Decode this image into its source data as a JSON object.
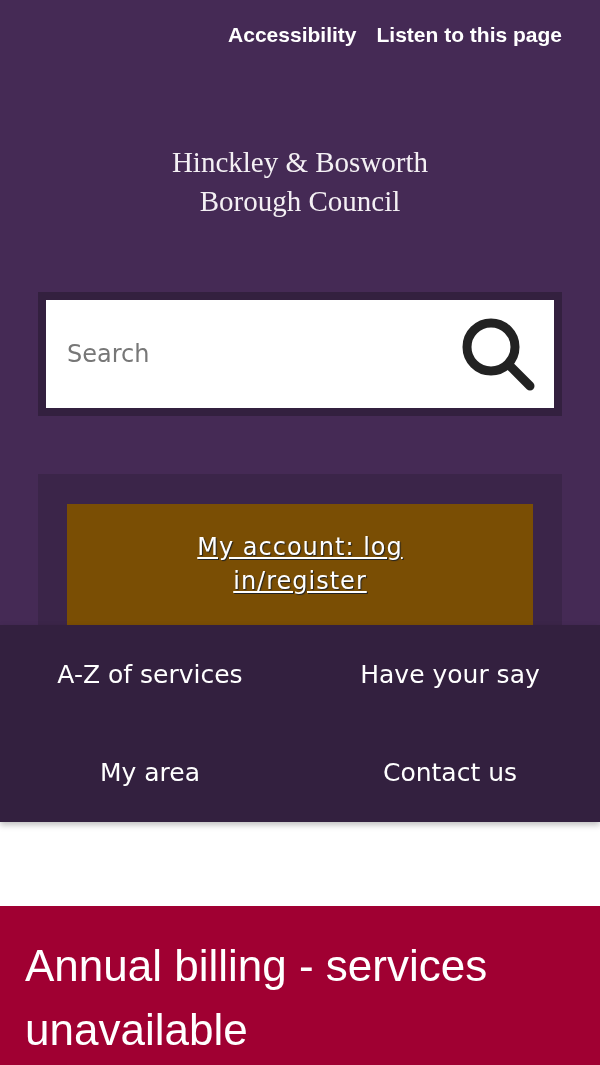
{
  "top_links": [
    "Accessibility",
    "Listen to this page"
  ],
  "logo": {
    "lines": [
      "Hinckley & Bosworth",
      "Borough Council"
    ]
  },
  "search": {
    "placeholder": "Search"
  },
  "account_button": "My account: log in/register",
  "nav": [
    "A-Z of services",
    "Have your say",
    "My area",
    "Contact us"
  ],
  "alert": {
    "title": "Annual billing - services unavailable"
  }
}
